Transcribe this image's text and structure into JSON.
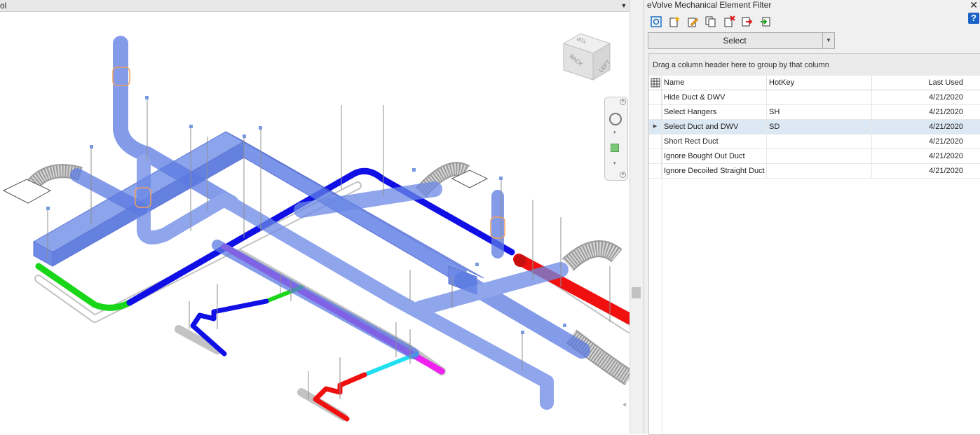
{
  "viewport": {
    "title": "ol",
    "viewcube": {
      "faces": [
        "TOP",
        "BACK",
        "LEFT"
      ]
    },
    "colors": {
      "duct": "#4a6ee0",
      "pipe_blue": "#1010e6",
      "pipe_green": "#19d619",
      "pipe_magenta": "#f020f0",
      "pipe_red": "#f01010",
      "pipe_cyan": "#20e0f0",
      "hanger": "#8f8f8f"
    }
  },
  "panel": {
    "title": "eVolve Mechanical Element Filter",
    "toolbar": [
      {
        "icon": "refresh-filter-icon"
      },
      {
        "icon": "new-filter-icon"
      },
      {
        "icon": "edit-filter-icon"
      },
      {
        "icon": "copy-filter-icon"
      },
      {
        "icon": "delete-filter-icon"
      },
      {
        "icon": "export-filter-icon"
      },
      {
        "icon": "import-filter-icon"
      }
    ],
    "help": "?",
    "select": {
      "label": "Select"
    },
    "grid": {
      "group_hint": "Drag a column header here to group by that column",
      "columns": [
        "Name",
        "HotKey",
        "Last Used"
      ],
      "rows": [
        {
          "name": "Hide Duct & DWV",
          "hotkey": "",
          "last_used": "4/21/2020"
        },
        {
          "name": "Select Hangers",
          "hotkey": "SH",
          "last_used": "4/21/2020"
        },
        {
          "name": "Select Duct and DWV",
          "hotkey": "SD",
          "last_used": "4/21/2020"
        },
        {
          "name": "Short Rect Duct",
          "hotkey": "",
          "last_used": "4/21/2020"
        },
        {
          "name": "Ignore Bought Out Duct",
          "hotkey": "",
          "last_used": "4/21/2020"
        },
        {
          "name": "Ignore Decoiled Straight Duct",
          "hotkey": "",
          "last_used": "4/21/2020"
        }
      ],
      "selected_row": 2
    }
  }
}
